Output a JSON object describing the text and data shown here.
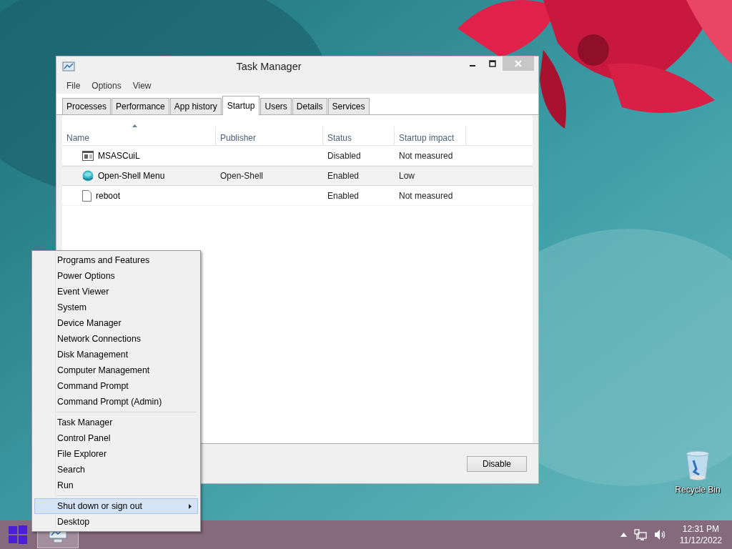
{
  "window": {
    "title": "Task Manager",
    "menu": [
      "File",
      "Options",
      "View"
    ],
    "tabs": [
      {
        "label": "Processes",
        "selected": false
      },
      {
        "label": "Performance",
        "selected": false
      },
      {
        "label": "App history",
        "selected": false
      },
      {
        "label": "Startup",
        "selected": true
      },
      {
        "label": "Users",
        "selected": false
      },
      {
        "label": "Details",
        "selected": false
      },
      {
        "label": "Services",
        "selected": false
      }
    ],
    "columns": [
      {
        "label": "Name",
        "sorted": true
      },
      {
        "label": "Publisher",
        "sorted": false
      },
      {
        "label": "Status",
        "sorted": false
      },
      {
        "label": "Startup impact",
        "sorted": false
      }
    ],
    "rows": [
      {
        "kind": "app",
        "name": "MSASCuiL",
        "publisher": "",
        "status": "Disabled",
        "impact": "Not measured",
        "selected": false
      },
      {
        "kind": "globe",
        "name": "Open-Shell Menu",
        "publisher": "Open-Shell",
        "status": "Enabled",
        "impact": "Low",
        "selected": true
      },
      {
        "kind": "file",
        "name": "reboot",
        "publisher": "",
        "status": "Enabled",
        "impact": "Not measured",
        "selected": false
      }
    ],
    "button": "Disable"
  },
  "context_menu": {
    "sections": [
      [
        {
          "label": "Programs and Features",
          "selected": false,
          "submenu": false
        },
        {
          "label": "Power Options",
          "selected": false,
          "submenu": false
        },
        {
          "label": "Event Viewer",
          "selected": false,
          "submenu": false
        },
        {
          "label": "System",
          "selected": false,
          "submenu": false
        },
        {
          "label": "Device Manager",
          "selected": false,
          "submenu": false
        },
        {
          "label": "Network Connections",
          "selected": false,
          "submenu": false
        },
        {
          "label": "Disk Management",
          "selected": false,
          "submenu": false
        },
        {
          "label": "Computer Management",
          "selected": false,
          "submenu": false
        },
        {
          "label": "Command Prompt",
          "selected": false,
          "submenu": false
        },
        {
          "label": "Command Prompt (Admin)",
          "selected": false,
          "submenu": false
        }
      ],
      [
        {
          "label": "Task Manager",
          "selected": false,
          "submenu": false
        },
        {
          "label": "Control Panel",
          "selected": false,
          "submenu": false
        },
        {
          "label": "File Explorer",
          "selected": false,
          "submenu": false
        },
        {
          "label": "Search",
          "selected": false,
          "submenu": false
        },
        {
          "label": "Run",
          "selected": false,
          "submenu": false
        }
      ],
      [
        {
          "label": "Shut down or sign out",
          "selected": true,
          "submenu": true
        },
        {
          "label": "Desktop",
          "selected": false,
          "submenu": false
        }
      ]
    ]
  },
  "desktop_icons": [
    {
      "label": "Recycle Bin"
    }
  ],
  "taskbar": {
    "time": "12:31 PM",
    "date": "11/12/2022"
  }
}
